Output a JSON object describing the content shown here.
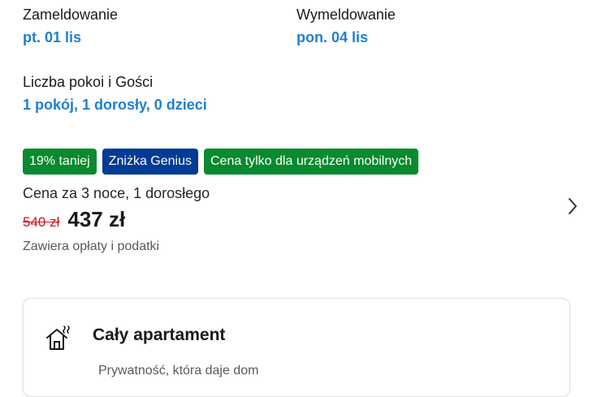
{
  "checkin": {
    "label": "Zameldowanie",
    "value": "pt. 01 lis"
  },
  "checkout": {
    "label": "Wymeldowanie",
    "value": "pon. 04 lis"
  },
  "rooms_guests": {
    "label": "Liczba pokoi i Gości",
    "value": "1 pokój, 1 dorosły, 0 dzieci"
  },
  "badges": [
    "19% taniej",
    "Zniżka Genius",
    "Cena tylko dla urządzeń mobilnych"
  ],
  "price": {
    "label": "Cena za 3 noce, 1 dorosłego",
    "old": "540 zł",
    "new": "437 zł",
    "note": "Zawiera opłaty i podatki"
  },
  "property": {
    "title": "Cały apartament",
    "subtitle": "Prywatność, która daje dom"
  },
  "colors": {
    "link": "#1f7fd0",
    "green_badge": "#088a2e",
    "genius_badge": "#003b95",
    "old_price": "#d4111e"
  }
}
